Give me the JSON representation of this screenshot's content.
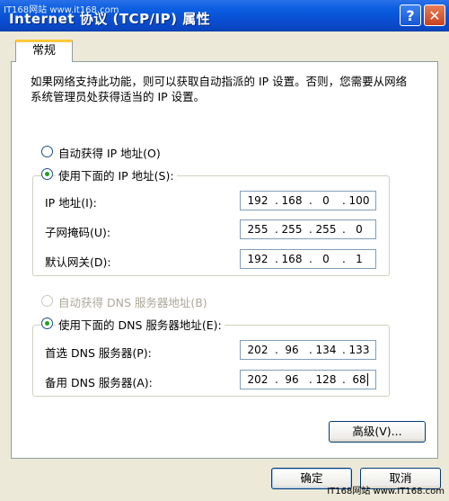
{
  "window": {
    "title": "Internet 协议 (TCP/IP) 属性",
    "watermark_top": "IT168网站 www.it168.com",
    "help_icon": "?",
    "close_icon": "✕"
  },
  "tabs": [
    {
      "label": "常规"
    }
  ],
  "description": "如果网络支持此功能，则可以获取自动指派的 IP 设置。否则，您需要从网络系统管理员处获得适当的 IP 设置。",
  "ip_section": {
    "auto_label": "自动获得 IP 地址(O)",
    "manual_label": "使用下面的 IP 地址(S):",
    "selected": "manual",
    "fields": [
      {
        "label": "IP 地址(I):",
        "value": [
          "192",
          "168",
          "0",
          "100"
        ]
      },
      {
        "label": "子网掩码(U):",
        "value": [
          "255",
          "255",
          "255",
          "0"
        ]
      },
      {
        "label": "默认网关(D):",
        "value": [
          "192",
          "168",
          "0",
          "1"
        ]
      }
    ]
  },
  "dns_section": {
    "auto_label": "自动获得 DNS 服务器地址(B)",
    "auto_disabled": true,
    "manual_label": "使用下面的 DNS 服务器地址(E):",
    "selected": "manual",
    "fields": [
      {
        "label": "首选 DNS 服务器(P):",
        "value": [
          "202",
          "96",
          "134",
          "133"
        ]
      },
      {
        "label": "备用 DNS 服务器(A):",
        "value": [
          "202",
          "96",
          "128",
          "68"
        ]
      }
    ]
  },
  "buttons": {
    "advanced": "高级(V)...",
    "ok": "确定",
    "cancel": "取消"
  },
  "watermark_bottom": "IT168网站 www.IT168.com"
}
